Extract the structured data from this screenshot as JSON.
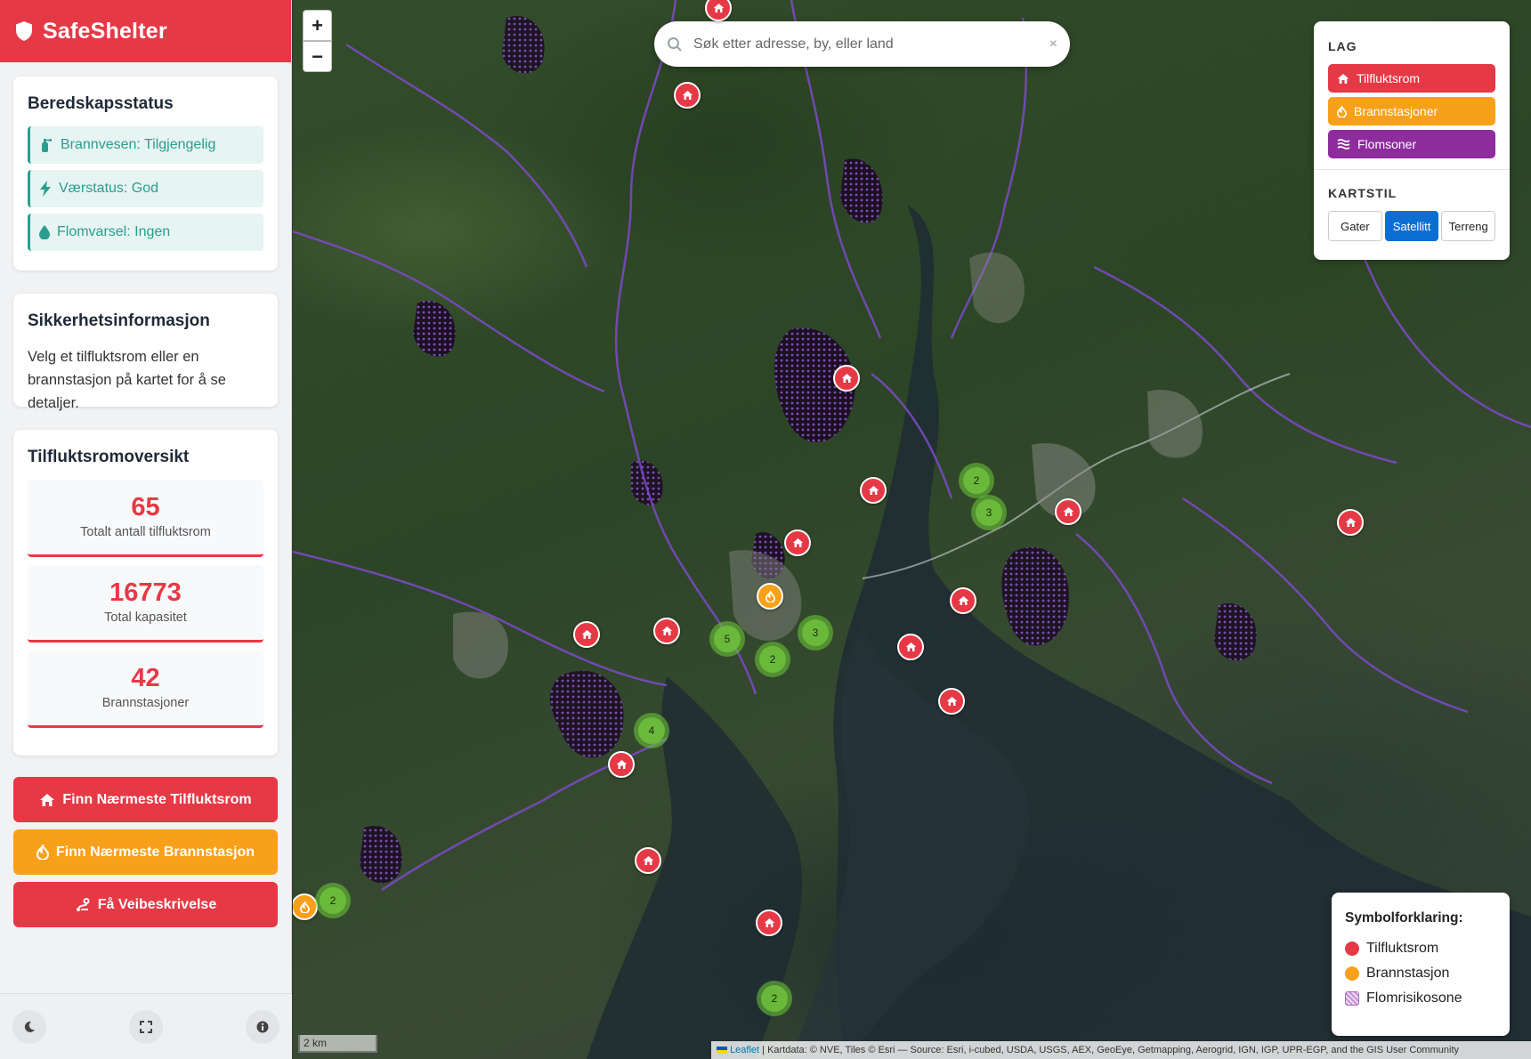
{
  "app": {
    "title": "SafeShelter"
  },
  "readiness": {
    "title": "Beredskapsstatus",
    "items": [
      {
        "label": "Brannvesen: Tilgjengelig",
        "icon": "fire-extinguisher-icon"
      },
      {
        "label": "Værstatus: God",
        "icon": "bolt-icon"
      },
      {
        "label": "Flomvarsel: Ingen",
        "icon": "droplet-icon"
      }
    ]
  },
  "safety": {
    "title": "Sikkerhetsinformasjon",
    "text": "Velg et tilfluktsrom eller en brannstasjon på kartet for å se detaljer."
  },
  "overview": {
    "title": "Tilfluktsromoversikt",
    "stats": [
      {
        "value": "65",
        "label": "Totalt antall tilfluktsrom"
      },
      {
        "value": "16773",
        "label": "Total kapasitet"
      },
      {
        "value": "42",
        "label": "Brannstasjoner"
      }
    ]
  },
  "actions": {
    "nearest_shelter": "Finn Nærmeste Tilfluktsrom",
    "nearest_fire": "Finn Nærmeste Brannstasjon",
    "directions": "Få Veibeskrivelse"
  },
  "footer": {
    "icons": [
      "moon-icon",
      "fullscreen-icon",
      "info-icon"
    ]
  },
  "map": {
    "zoom_in": "+",
    "zoom_out": "−",
    "search_placeholder": "Søk etter adresse, by, eller land",
    "search_clear": "×",
    "scale": "2 km",
    "attribution_link": "Leaflet",
    "attribution_text": " | Kartdata: © NVE, Tiles © Esri — Source: Esri, i-cubed, USDA, USGS, AEX, GeoEye, Getmapping, Aerogrid, IGN, IGP, UPR-EGP, and the GIS User Community"
  },
  "layers": {
    "title": "LAG",
    "items": [
      {
        "label": "Tilfluktsrom",
        "color": "#e63946",
        "icon": "house-icon"
      },
      {
        "label": "Brannstasjoner",
        "color": "#f9a01b",
        "icon": "flame-icon"
      },
      {
        "label": "Flomsoner",
        "color": "#8e2c9e",
        "icon": "water-icon"
      }
    ],
    "style_title": "KARTSTIL",
    "styles": [
      "Gater",
      "Satellitt",
      "Terreng"
    ],
    "active_style": "Satellitt"
  },
  "legend": {
    "title": "Symbolforklaring:",
    "items": [
      {
        "label": "Tilfluktsrom",
        "color": "#e63946"
      },
      {
        "label": "Brannstasjon",
        "color": "#f9a01b"
      },
      {
        "label": "Flomrisikosone",
        "color": "#c58fd6"
      }
    ]
  },
  "clusters": [
    "2",
    "3",
    "5",
    "2",
    "3",
    "4",
    "2",
    "2"
  ],
  "colors": {
    "primary": "#e63946",
    "accent": "#f9a01b",
    "teal": "#2a9d8f",
    "flood": "#8e2c9e",
    "active": "#0b6fd1"
  }
}
